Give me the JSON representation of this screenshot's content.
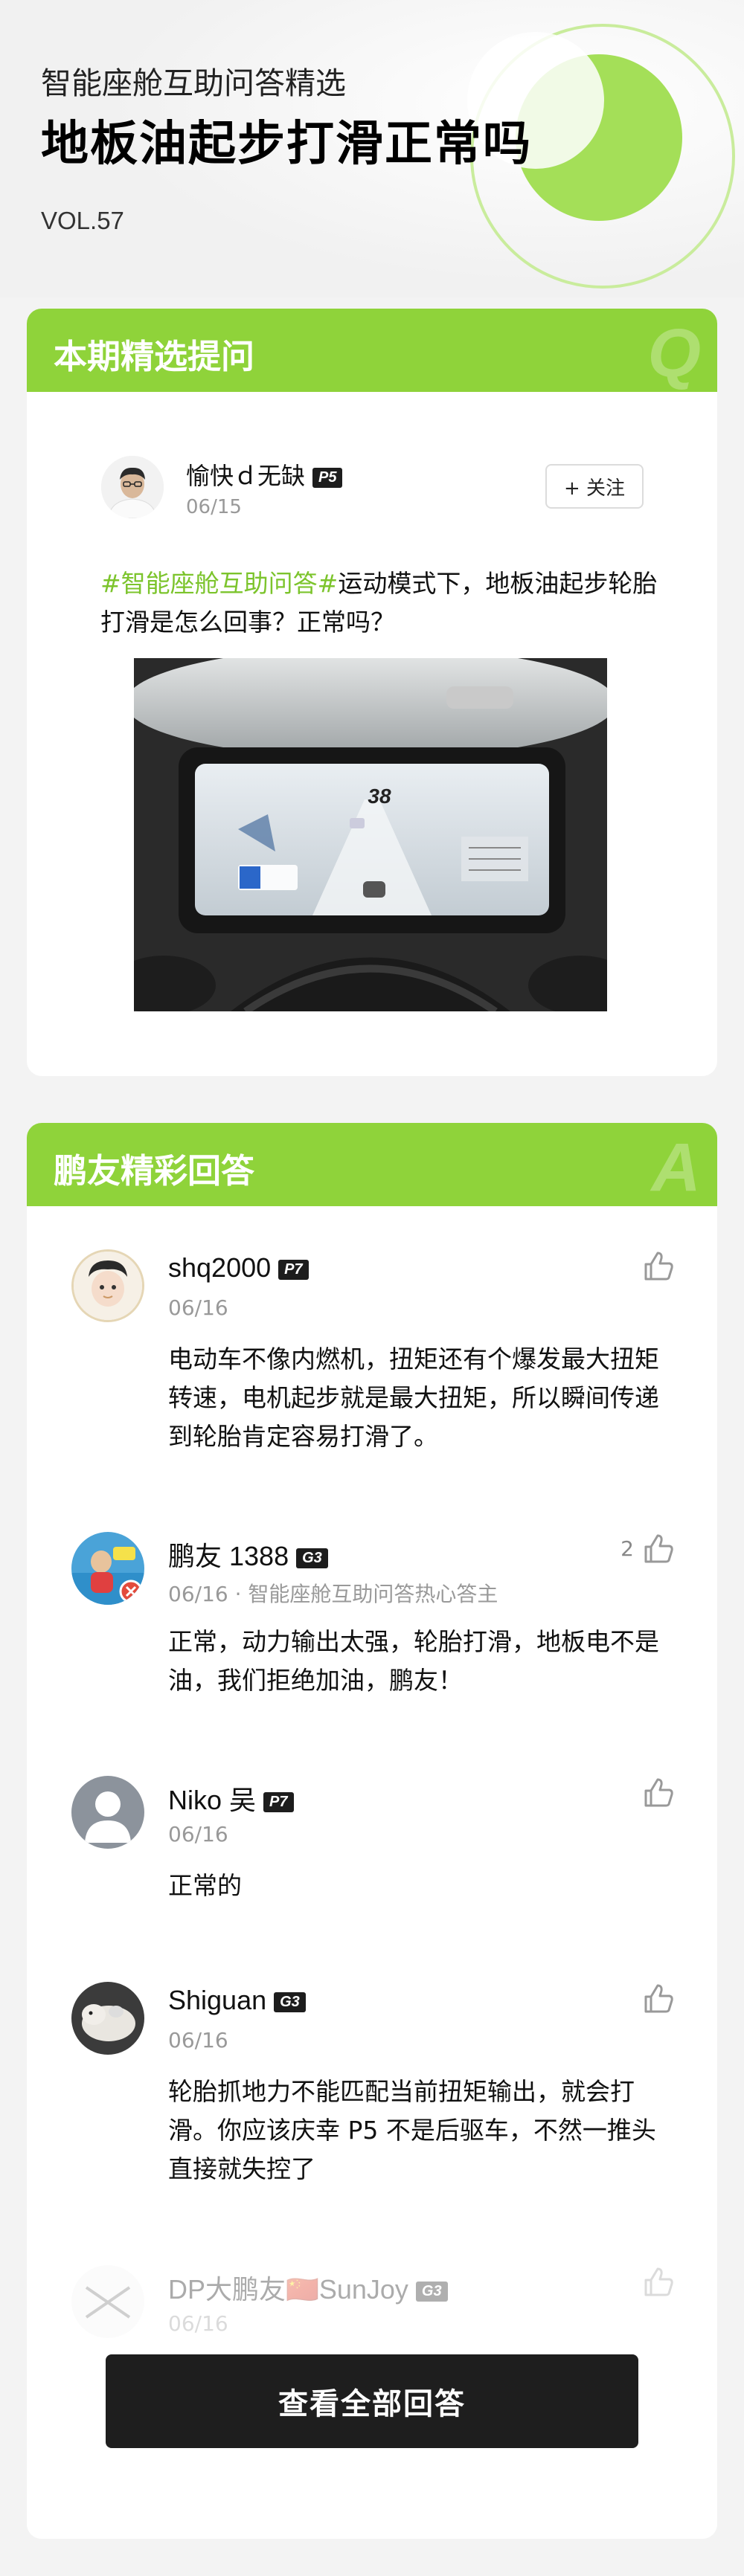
{
  "header": {
    "subtitle": "智能座舱互助问答精选",
    "title": "地板油起步打滑正常吗",
    "volume": "VOL.57"
  },
  "question_section": {
    "title": "本期精选提问",
    "mark": "Q",
    "user": {
      "name": "愉快ｄ无缺",
      "level": "P5",
      "date": "06/15"
    },
    "follow_label": "+ 关注",
    "tag": "#智能座舱互助问答#",
    "text": "运动模式下，地板油起步轮胎打滑是怎么回事？正常吗？",
    "image": {
      "speed": "38"
    }
  },
  "answer_section": {
    "title": "鹏友精彩回答",
    "mark": "A",
    "answers": [
      {
        "name": "shq2000",
        "level": "P7",
        "meta": "06/16",
        "text": "电动车不像内燃机，扭矩还有个爆发最大扭矩转速，电机起步就是最大扭矩，所以瞬间传递到轮胎肯定容易打滑了。",
        "likes": ""
      },
      {
        "name": "鹏友 1388",
        "level": "G3",
        "meta": "06/16 · 智能座舱互助问答热心答主",
        "text": "正常，动力输出太强，轮胎打滑，地板电不是油，我们拒绝加油，鹏友！",
        "likes": "2"
      },
      {
        "name": "Niko 吴",
        "level": "P7",
        "meta": "06/16",
        "text": "正常的",
        "likes": ""
      },
      {
        "name": "Shiguan",
        "level": "G3",
        "meta": "06/16",
        "text": "轮胎抓地力不能匹配当前扭矩输出，就会打滑。你应该庆幸 P5 不是后驱车，不然一推头直接就失控了",
        "likes": ""
      },
      {
        "name": "DP大鹏友🇨🇳SunJoy",
        "level": "G3",
        "meta": "06/16",
        "text": "",
        "likes": ""
      }
    ],
    "view_all_label": "查看全部回答"
  },
  "colors": {
    "accent": "#8fd33a",
    "tag": "#7cc42c",
    "button": "#1e1e1e"
  }
}
